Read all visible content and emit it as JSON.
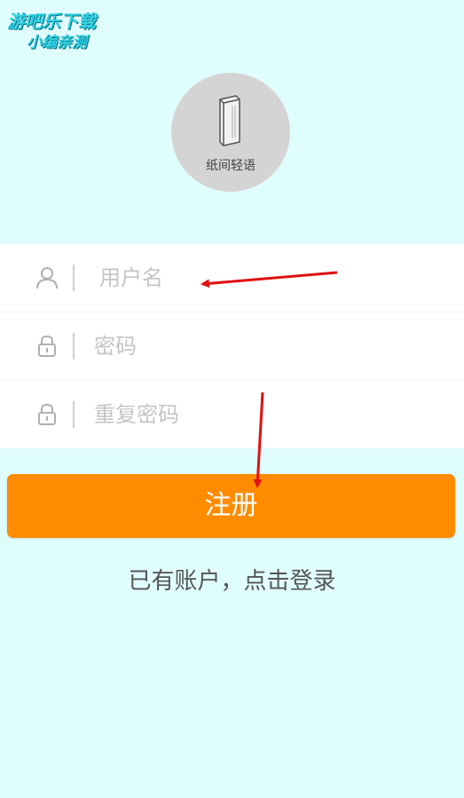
{
  "watermark": {
    "line1": "游吧乐下载",
    "line2": "小编亲测"
  },
  "logo": {
    "icon": "book-icon",
    "text": "纸间轻语"
  },
  "fields": {
    "username": {
      "placeholder": "用户名",
      "icon": "user-icon"
    },
    "password": {
      "placeholder": "密码",
      "icon": "lock-icon"
    },
    "confirm_password": {
      "placeholder": "重复密码",
      "icon": "lock-icon"
    }
  },
  "register_button": {
    "label": "注册"
  },
  "login_link": {
    "text": "已有账户，点击登录"
  },
  "colors": {
    "background": "#e0fdfe",
    "accent": "#ff8c00",
    "arrow": "#e01010"
  }
}
